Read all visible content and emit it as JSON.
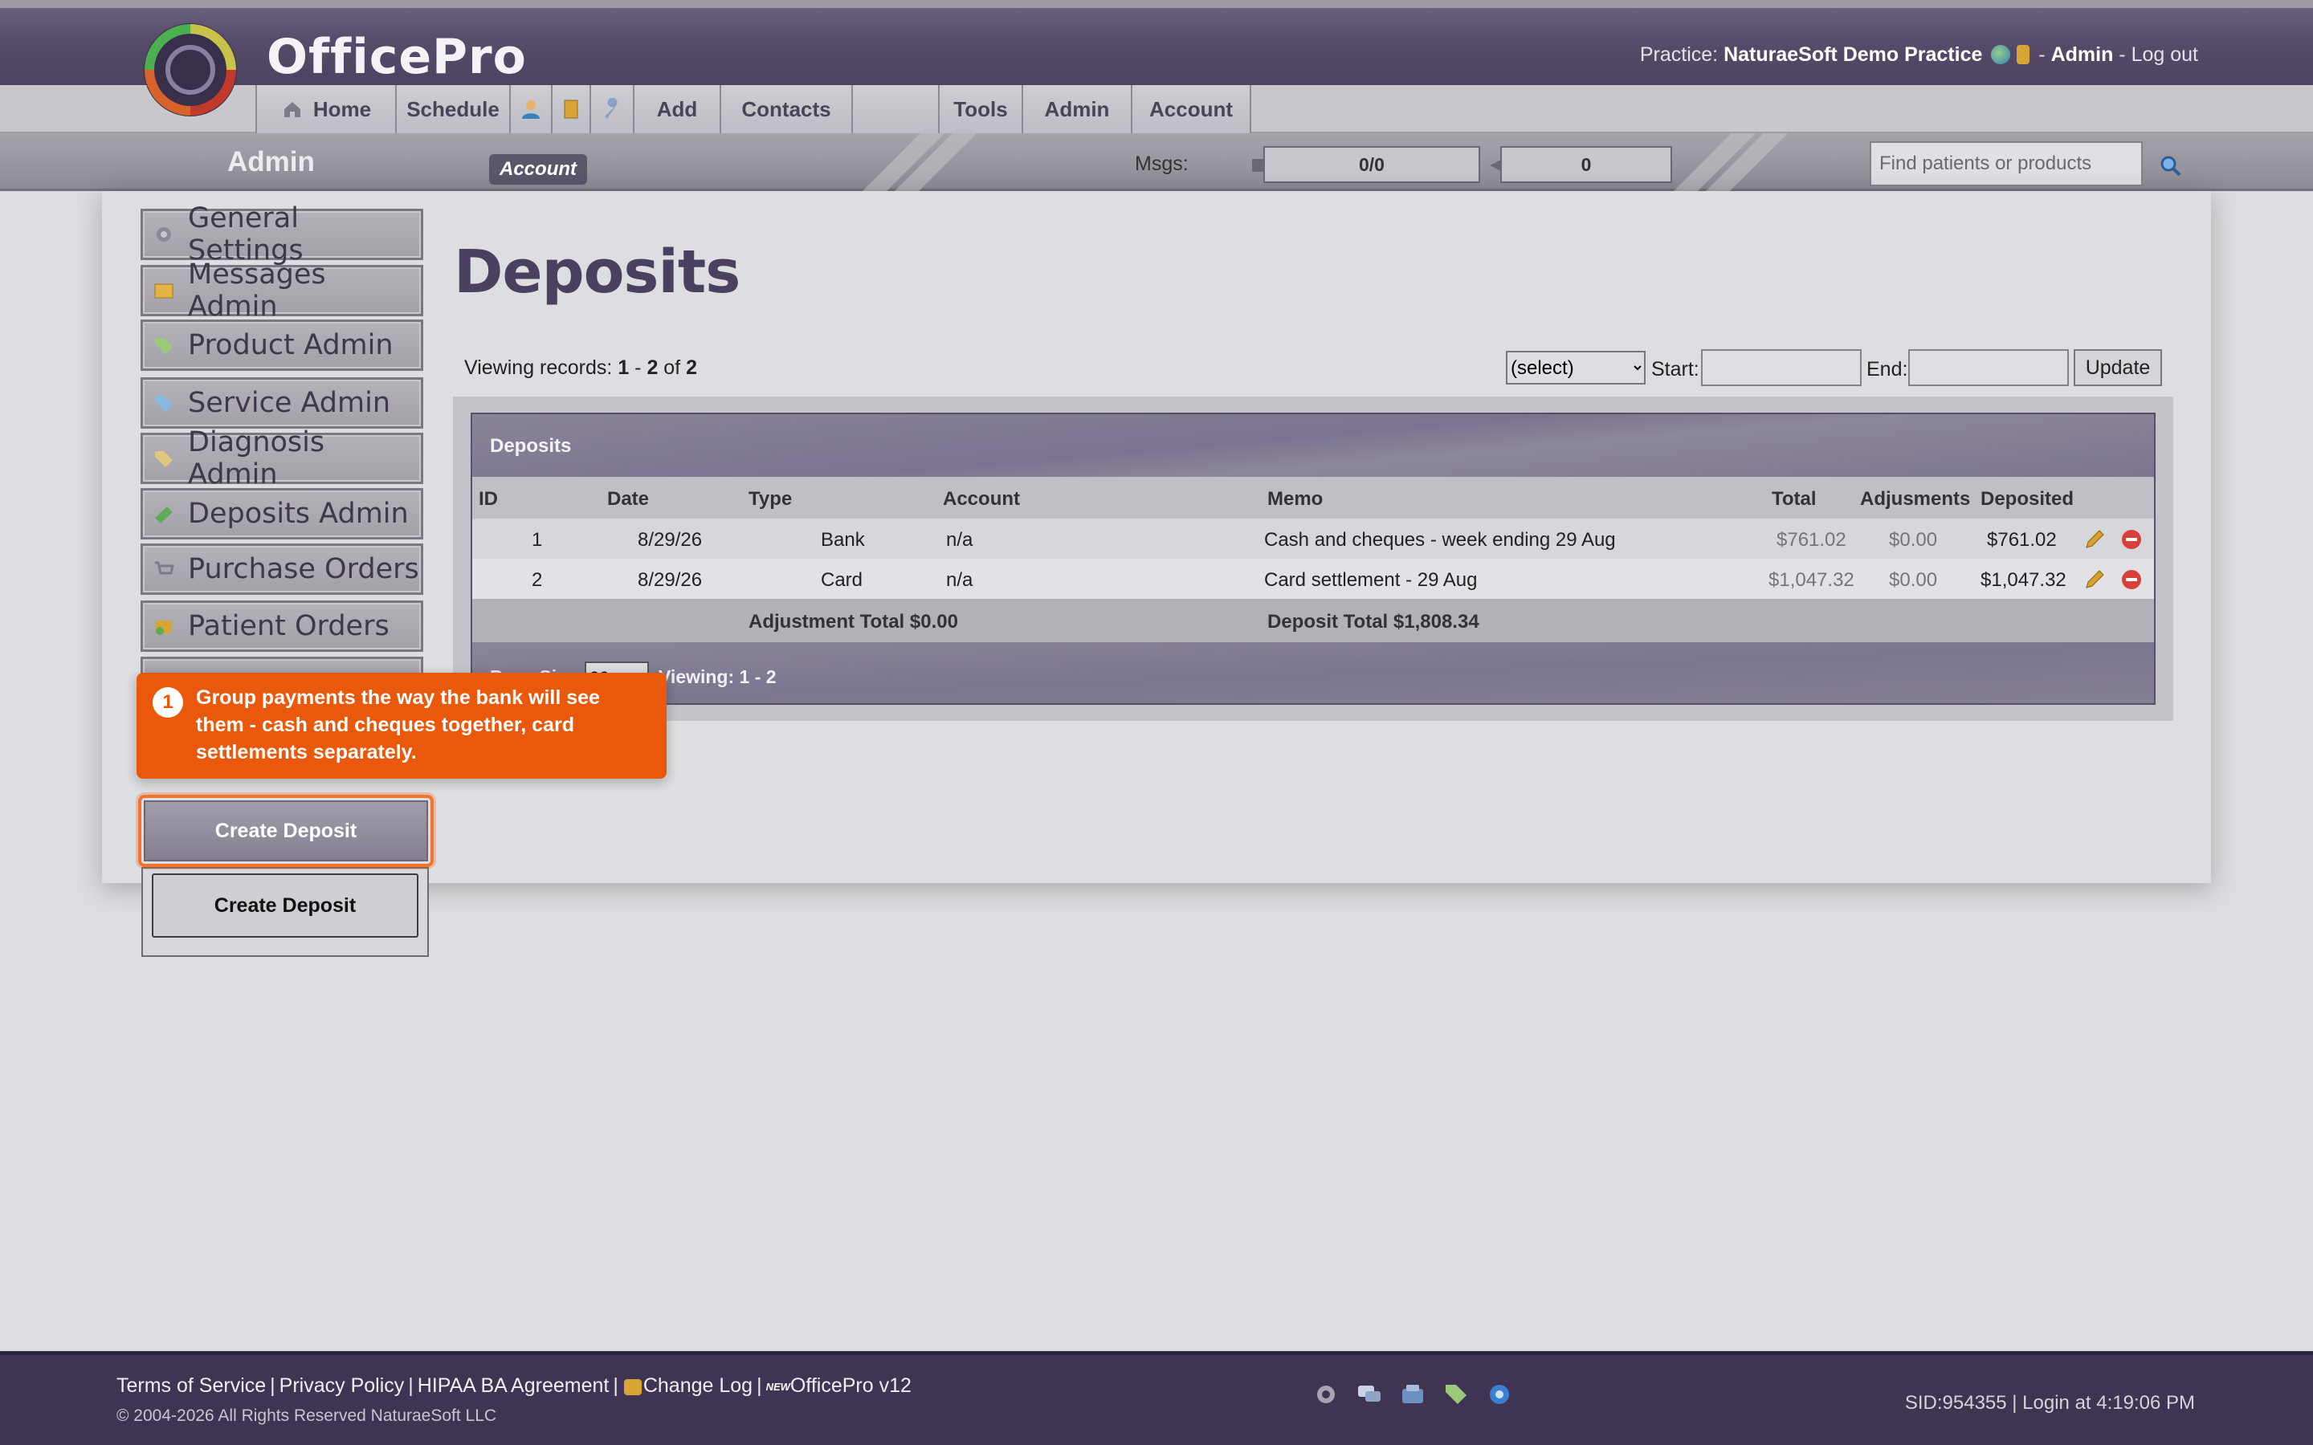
{
  "header": {
    "brand": "OfficePro",
    "practice_label": "Practice:",
    "practice_name": "NaturaeSoft Demo Practice",
    "user": "Admin",
    "logout": "Log out"
  },
  "nav": {
    "tabs": [
      {
        "label": "Home",
        "icon": "home-icon"
      },
      {
        "label": "Schedule"
      },
      {
        "label": "",
        "icon": "patient-icon"
      },
      {
        "label": "",
        "icon": "notebook-icon"
      },
      {
        "label": "",
        "icon": "wrench-icon"
      },
      {
        "label": "Add"
      },
      {
        "label": "Contacts"
      },
      {
        "label": ""
      },
      {
        "label": "Tools"
      },
      {
        "label": "Admin"
      },
      {
        "label": "Account"
      }
    ]
  },
  "subbar": {
    "title": "Admin",
    "account_pill": "Account",
    "msgs_label": "Msgs:",
    "msgs_count": "0/0",
    "outbox_count": "0",
    "search_placeholder": "Find patients or products"
  },
  "sidebar": {
    "items": [
      {
        "label": "General Settings",
        "icon": "gear-icon"
      },
      {
        "label": "Messages Admin",
        "icon": "envelope-icon"
      },
      {
        "label": "Product Admin",
        "icon": "tag-icon"
      },
      {
        "label": "Service Admin",
        "icon": "tag-icon"
      },
      {
        "label": "Diagnosis Admin",
        "icon": "tag-icon"
      },
      {
        "label": "Deposits Admin",
        "icon": "money-icon"
      },
      {
        "label": "Purchase Orders",
        "icon": "cart-icon"
      },
      {
        "label": "Patient Orders",
        "icon": "box-icon"
      }
    ],
    "create_deposit": "Create Deposit",
    "create_deposit_secondary": "Create Deposit"
  },
  "page": {
    "title": "Deposits",
    "viewing_prefix": "Viewing records:",
    "viewing_from": "1",
    "viewing_to": "2",
    "viewing_total": "2",
    "filter_select": "(select)",
    "start_label": "Start:",
    "end_label": "End:",
    "update_button": "Update"
  },
  "grid": {
    "caption": "Deposits",
    "columns": [
      "ID",
      "Date",
      "Type",
      "Account",
      "Memo",
      "Total",
      "Adjusments",
      "Deposited"
    ],
    "rows": [
      {
        "id": "1",
        "date": "8/29/26",
        "type": "Bank",
        "account": "n/a",
        "memo": "Cash and cheques - week ending 29 Aug",
        "total": "$761.02",
        "adjustments": "$0.00",
        "deposited": "$761.02"
      },
      {
        "id": "2",
        "date": "8/29/26",
        "type": "Card",
        "account": "n/a",
        "memo": "Card settlement - 29 Aug",
        "total": "$1,047.32",
        "adjustments": "$0.00",
        "deposited": "$1,047.32"
      }
    ],
    "adjustment_total": "Adjustment Total $0.00",
    "deposit_total": "Deposit Total $1,808.34",
    "page_size_label": "Page Size:",
    "page_size": "20",
    "footer_viewing": "Viewing: 1 - 2"
  },
  "tooltip": {
    "step": "1",
    "text": "Group payments the way the bank will see them - cash and cheques together, card settlements separately."
  },
  "footer": {
    "links": [
      "Terms of Service",
      "Privacy Policy",
      "HIPAA BA Agreement",
      "Change Log",
      "OfficePro v12"
    ],
    "new_badge": "NEW",
    "copyright": "© 2004-2026 All Rights Reserved NaturaeSoft LLC",
    "session": "SID:954355 | Login at 4:19:06 PM"
  },
  "colors": {
    "header": "#574c69",
    "accent": "#ea580c",
    "footer": "#3f3452",
    "title": "#4a4160"
  }
}
